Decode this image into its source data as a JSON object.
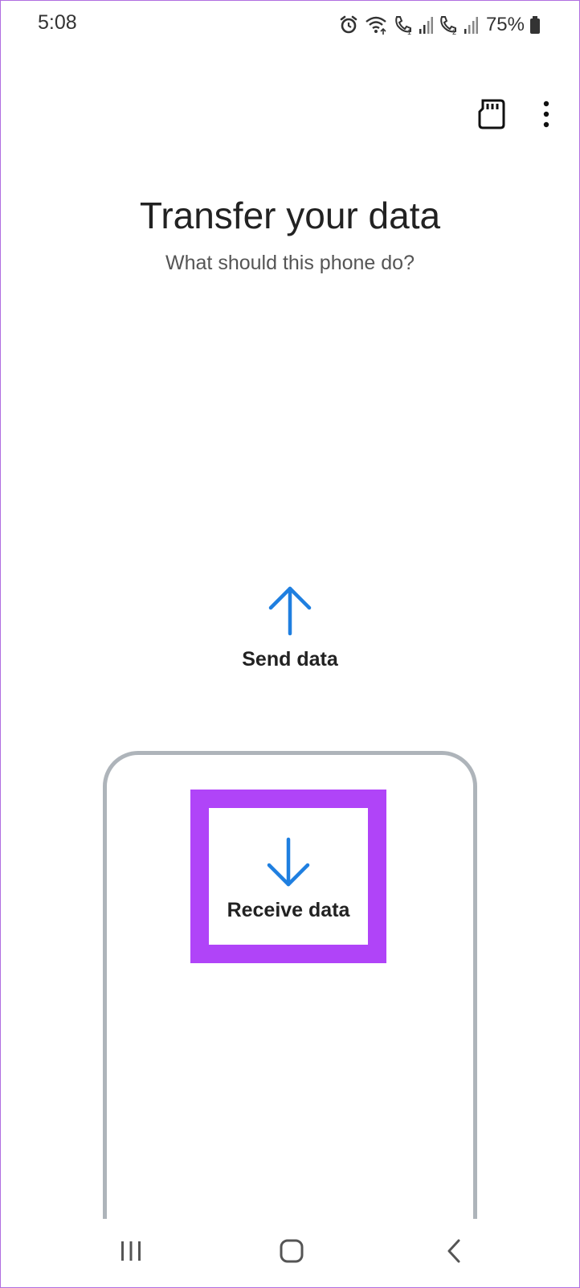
{
  "status_bar": {
    "time": "5:08",
    "battery": "75%",
    "icons": [
      "alarm-icon",
      "wifi-icon",
      "call-sim1-icon",
      "signal-icon",
      "call-sim2-icon",
      "signal-icon",
      "battery-icon"
    ]
  },
  "action_bar": {
    "icons": [
      "sd-card-icon",
      "more-vertical-icon"
    ]
  },
  "header": {
    "title": "Transfer your data",
    "subtitle": "What should this phone do?"
  },
  "options": {
    "send_label": "Send data",
    "receive_label": "Receive data"
  },
  "colors": {
    "accent_blue": "#1f7fe0",
    "highlight_purple": "#b044f8",
    "phone_outline": "#aeb4ba"
  },
  "nav_bar": {
    "icons": [
      "recents-icon",
      "home-icon",
      "back-icon"
    ]
  }
}
